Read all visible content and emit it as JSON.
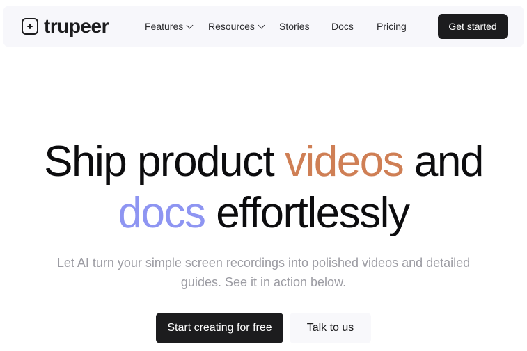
{
  "brand": {
    "name": "trupeer",
    "logo_icon": "plus-square-icon"
  },
  "nav": {
    "items": [
      {
        "label": "Features",
        "has_dropdown": true
      },
      {
        "label": "Resources",
        "has_dropdown": true
      },
      {
        "label": "Stories",
        "has_dropdown": false
      },
      {
        "label": "Docs",
        "has_dropdown": false
      },
      {
        "label": "Pricing",
        "has_dropdown": false
      }
    ],
    "cta_label": "Get started"
  },
  "hero": {
    "title_part1": "Ship product ",
    "title_accent1": "videos",
    "title_part2": " and",
    "title_accent2": "docs",
    "title_part3": " effortlessly",
    "subtitle": "Let AI turn your simple screen recordings into polished videos and detailed guides. See it in action below.",
    "primary_cta": "Start creating for free",
    "secondary_cta": "Talk to us"
  },
  "colors": {
    "accent_orange": "#cf7f55",
    "accent_purple": "#8e95f2",
    "dark": "#1c1c1e",
    "muted_text": "#9c9ca3"
  }
}
